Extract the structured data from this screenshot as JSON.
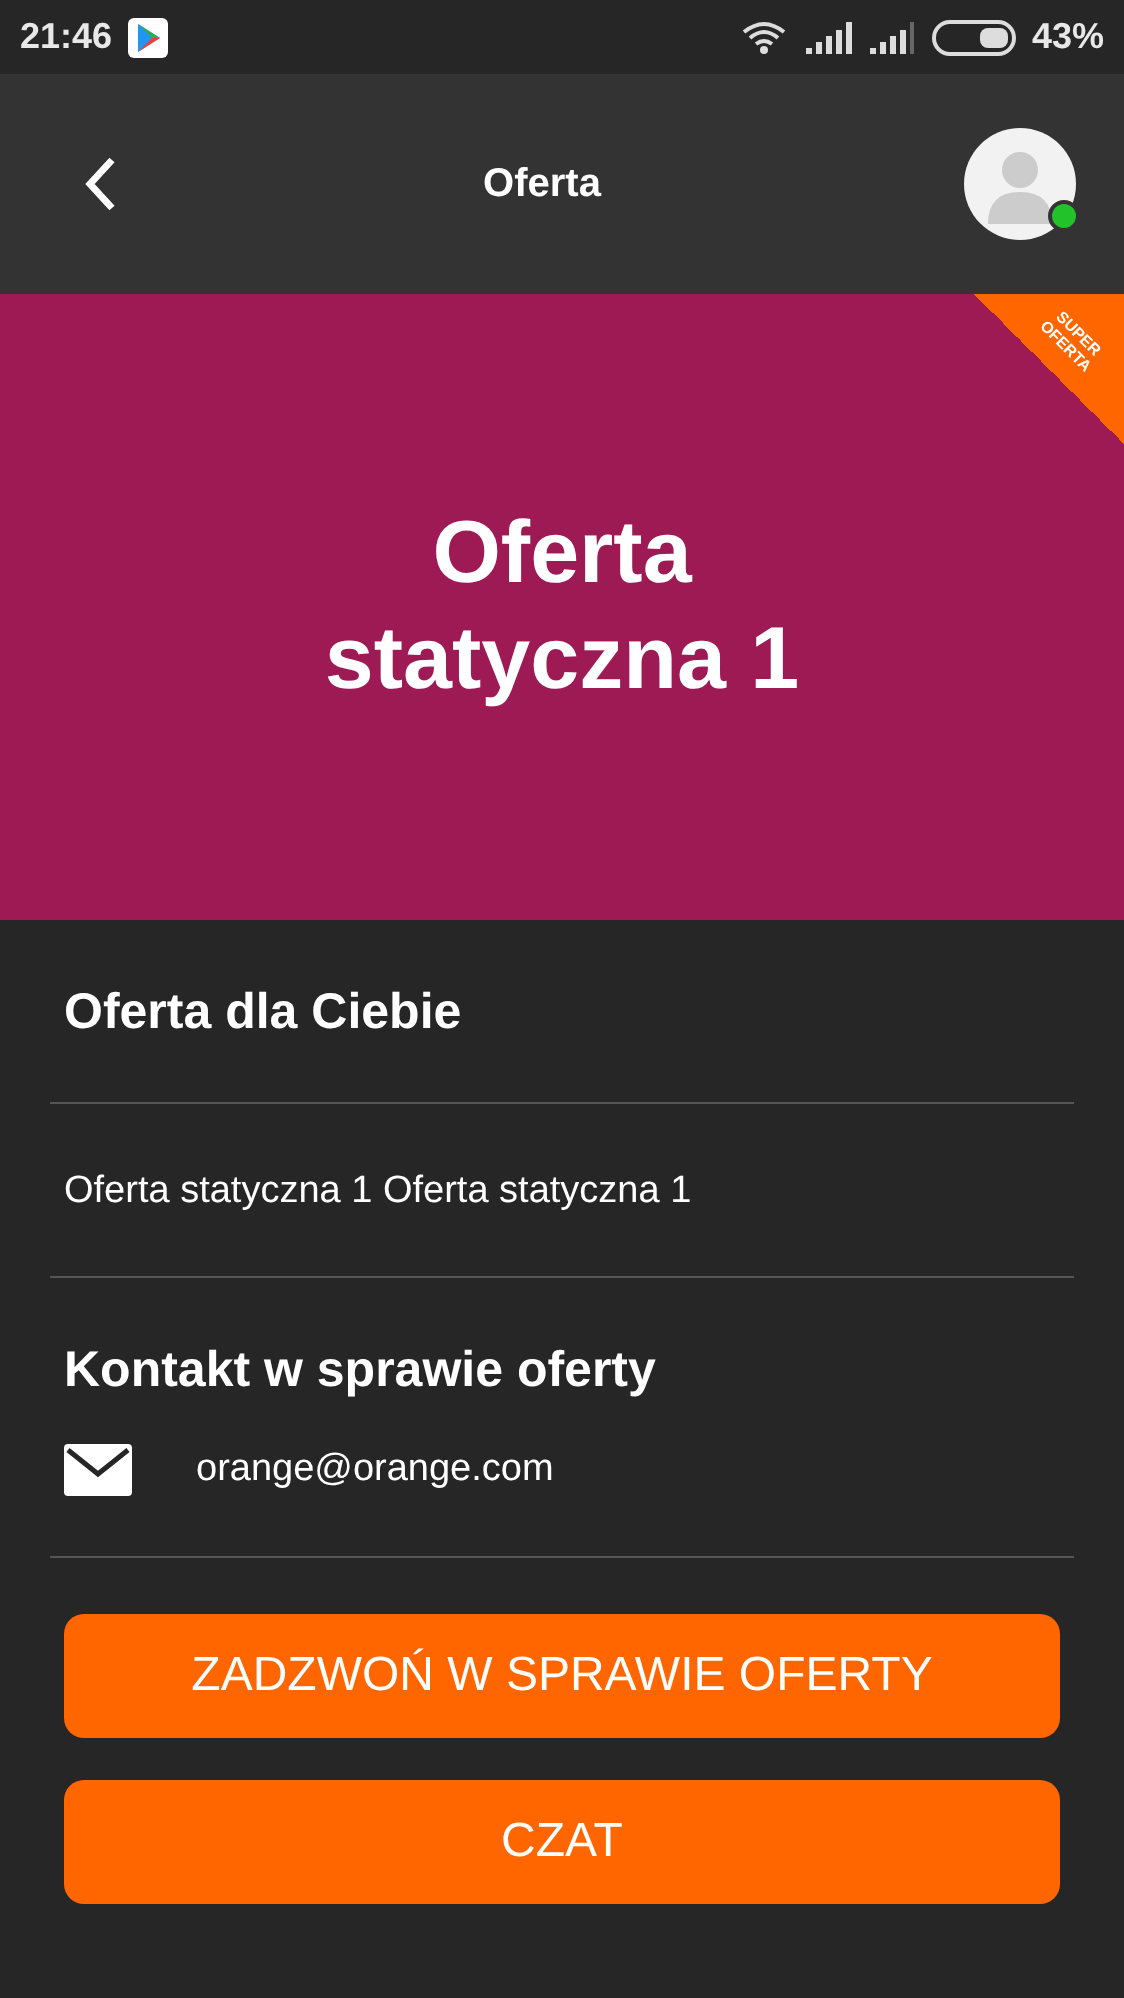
{
  "status_bar": {
    "time": "21:46",
    "battery": "43%"
  },
  "header": {
    "title": "Oferta",
    "avatar": {
      "online": true
    }
  },
  "banner": {
    "title": "Oferta statyczna 1",
    "ribbon": [
      "SUPER",
      "OFERTA"
    ]
  },
  "sections": [
    {
      "heading": "Oferta dla Ciebie",
      "text": "Oferta statyczna 1 Oferta statyczna 1"
    },
    {
      "heading": "Kontakt w sprawie oferty",
      "email": "orange@orange.com"
    }
  ],
  "buttons": [
    "ZADZWOŃ W SPRAWIE OFERTY",
    "CZAT"
  ]
}
